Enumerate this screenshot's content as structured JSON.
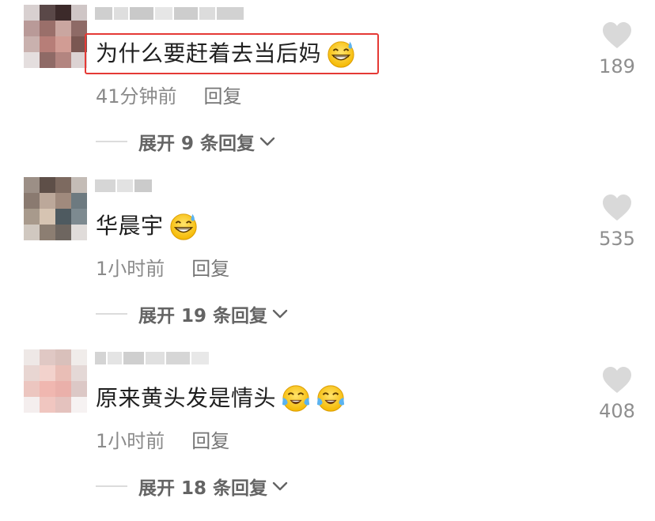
{
  "comments": [
    {
      "text": "为什么要赶着去当后妈",
      "emojis": [
        "grinning-sweat-emoji"
      ],
      "time": "41分钟前",
      "reply_label": "回复",
      "expand_label": "展开 9 条回复",
      "likes": "189",
      "highlighted": true
    },
    {
      "text": "华晨宇",
      "emojis": [
        "grinning-sweat-emoji"
      ],
      "time": "1小时前",
      "reply_label": "回复",
      "expand_label": "展开 19 条回复",
      "likes": "535",
      "highlighted": false
    },
    {
      "text": "原来黄头发是情头",
      "emojis": [
        "tears-of-joy-emoji",
        "tears-of-joy-emoji"
      ],
      "time": "1小时前",
      "reply_label": "回复",
      "expand_label": "展开 18 条回复",
      "likes": "408",
      "highlighted": false
    }
  ],
  "colors": {
    "highlight_border": "#e53935",
    "heart": "#d9d9d9",
    "text": "#1f1f1f",
    "meta": "#8a8a8a"
  },
  "icons": [
    "heart-icon",
    "chevron-down-icon",
    "grinning-sweat-emoji",
    "tears-of-joy-emoji"
  ]
}
